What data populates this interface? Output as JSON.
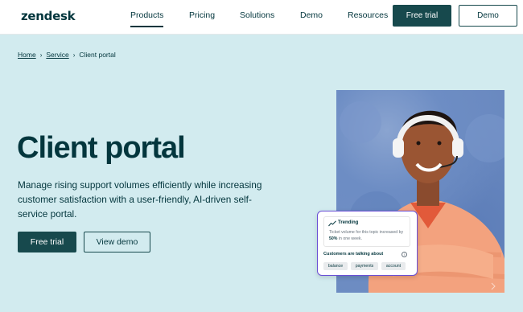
{
  "header": {
    "logo": "zendesk",
    "nav": [
      {
        "label": "Products",
        "active": true
      },
      {
        "label": "Pricing"
      },
      {
        "label": "Solutions"
      },
      {
        "label": "Demo"
      },
      {
        "label": "Resources"
      }
    ],
    "free_trial_label": "Free trial",
    "demo_label": "Demo"
  },
  "breadcrumb": {
    "items": [
      "Home",
      "Service",
      "Client portal"
    ],
    "separator": "›"
  },
  "hero": {
    "title": "Client portal",
    "description": "Manage rising support volumes efficiently while increasing customer satisfaction with a user-friendly, AI-driven self-service portal.",
    "primary_cta": "Free trial",
    "secondary_cta": "View demo"
  },
  "card": {
    "trend_label": "Trending",
    "trend_text_before": "Ticket volume for this topic increased by",
    "trend_percent": "50%",
    "trend_text_after": "in one week.",
    "talking_label": "Customers are talking about",
    "info_glyph": "i",
    "tags": [
      "balance",
      "payments",
      "account"
    ]
  },
  "colors": {
    "brand": "#03363d",
    "button": "#17494d",
    "page_bg": "#d2ebef",
    "card_border": "#6a4fd6"
  }
}
